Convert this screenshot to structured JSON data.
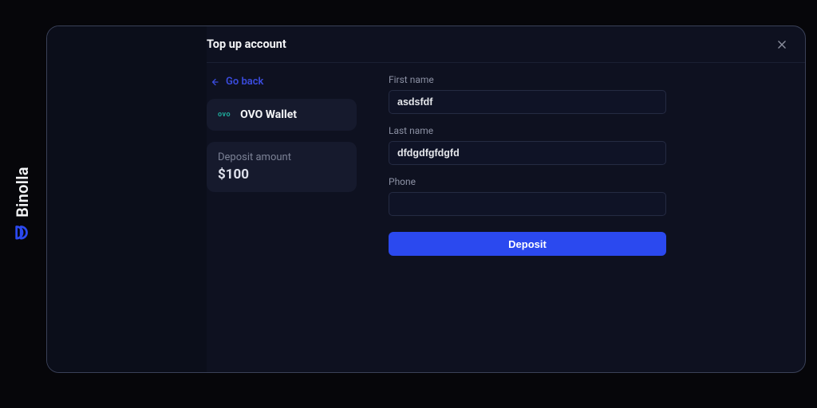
{
  "brand": {
    "name": "Binolla"
  },
  "modal": {
    "title": "Top up account",
    "go_back": "Go back",
    "method": {
      "icon_text": "ovo",
      "name": "OVO Wallet"
    },
    "deposit_amount": {
      "label": "Deposit amount",
      "value": "$100"
    },
    "form": {
      "first_name": {
        "label": "First name",
        "value": "asdsfdf"
      },
      "last_name": {
        "label": "Last name",
        "value": "dfdgdfgfdgfd"
      },
      "phone": {
        "label": "Phone",
        "value": ""
      },
      "submit": "Deposit"
    }
  }
}
